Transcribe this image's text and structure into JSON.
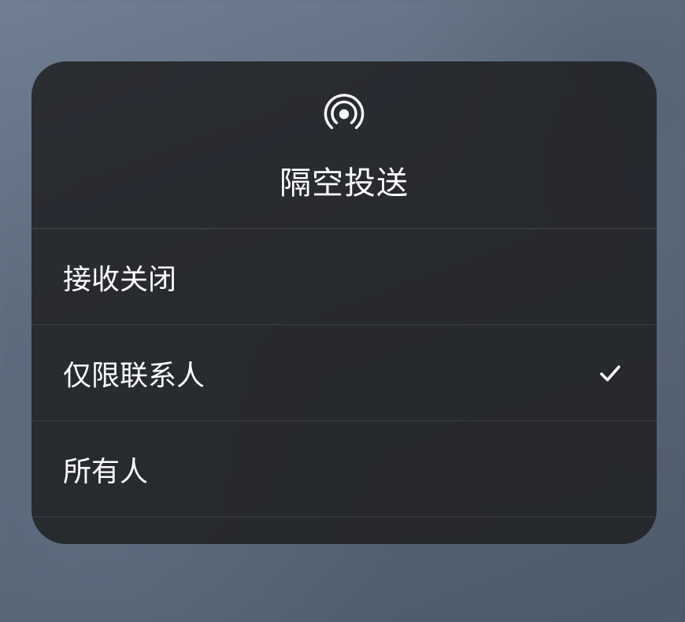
{
  "modal": {
    "title": "隔空投送",
    "icon": "airdrop-icon",
    "options": [
      {
        "label": "接收关闭",
        "selected": false
      },
      {
        "label": "仅限联系人",
        "selected": true
      },
      {
        "label": "所有人",
        "selected": false
      }
    ]
  }
}
